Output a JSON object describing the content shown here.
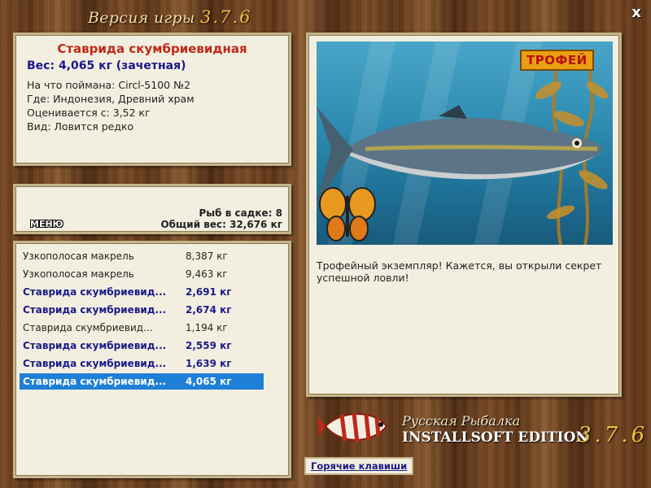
{
  "window": {
    "title_prefix": "Версия игры",
    "title_version": "3.7.6",
    "close_label": "x"
  },
  "fish_info": {
    "name": "Ставрида скумбриевидная",
    "weight": "Вес: 4,065 кг (зачетная)",
    "lines": [
      "На что поймана: Circl-5100 №2",
      "Где: Индонезия, Древний храм",
      "Оценивается с: 3,52 кг",
      "Вид: Ловится редко"
    ]
  },
  "stats": {
    "menu_label": "МЕНЮ",
    "in_keepnet": "Рыб в садке: 8",
    "total_weight": "Общий вес: 32,676 кг"
  },
  "catch_list": [
    {
      "name": "Узкополосая макрель",
      "weight": "8,387 кг",
      "trophy": false,
      "selected": false
    },
    {
      "name": "Узкополосая макрель",
      "weight": "9,463 кг",
      "trophy": false,
      "selected": false
    },
    {
      "name": "Ставрида скумбриевид...",
      "weight": "2,691 кг",
      "trophy": true,
      "selected": false
    },
    {
      "name": "Ставрида скумбриевид...",
      "weight": "2,674 кг",
      "trophy": true,
      "selected": false
    },
    {
      "name": "Ставрида скумбриевид...",
      "weight": "1,194 кг",
      "trophy": false,
      "selected": false
    },
    {
      "name": "Ставрида скумбриевид...",
      "weight": "2,559 кг",
      "trophy": true,
      "selected": false
    },
    {
      "name": "Ставрида скумбриевид...",
      "weight": "1,639 кг",
      "trophy": true,
      "selected": false
    },
    {
      "name": "Ставрида скумбриевид...",
      "weight": "4,065 кг",
      "trophy": true,
      "selected": true
    }
  ],
  "photo": {
    "badge": "ТРОФЕЙ",
    "description": "Трофейный экземпляр! Кажется, вы открыли секрет успешной ловли!"
  },
  "logo": {
    "line1": "Русская Рыбалка",
    "line2": "INSTALLSOFT EDITION",
    "version": "3.7.6"
  },
  "hotkeys_label": "Горячие клавиши",
  "colors": {
    "fish_name": "#c0281a",
    "trophy_text": "#1a1a8a",
    "selection": "#1e7fd6",
    "badge": "#e8a010"
  }
}
